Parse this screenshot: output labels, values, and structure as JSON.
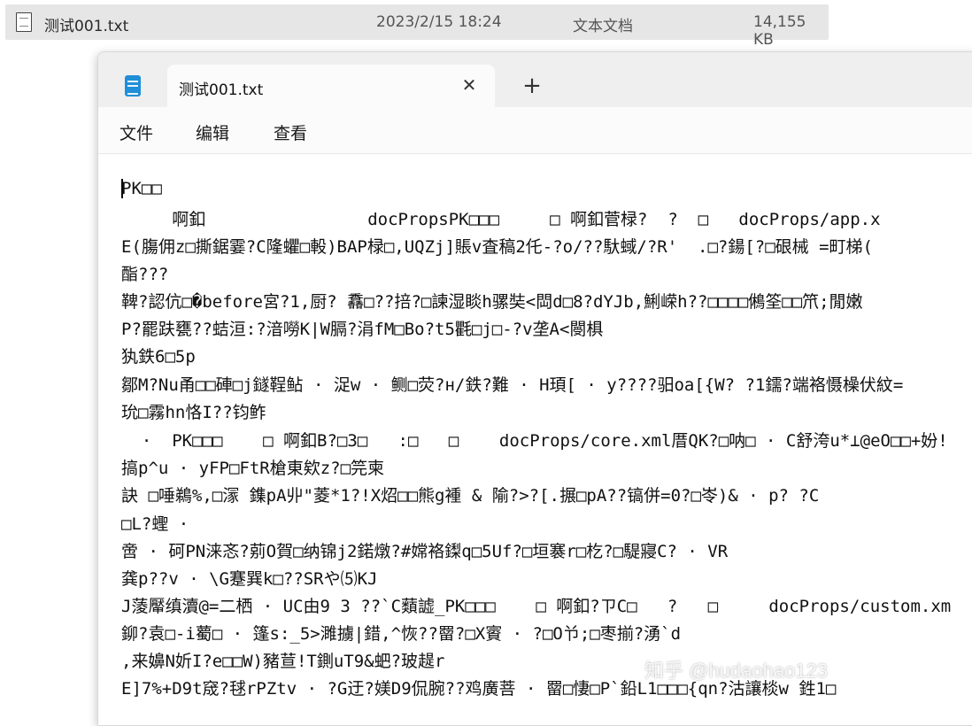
{
  "explorer": {
    "file_name": "测试001.txt",
    "modified": "2023/2/15 18:24",
    "type": "文本文档",
    "size": "14,155 KB"
  },
  "notepad": {
    "tab_title": "测试001.txt",
    "close_glyph": "✕",
    "new_tab_glyph": "+",
    "menu": [
      "文件",
      "编辑",
      "查看"
    ],
    "lines": [
      "PK□□",
      "     啊釦                docPropsPK□□□     □ 啊釦菅椂?  ?  □   docProps/app.x",
      "E(膓佣z□撕鋸霎?C隆蠷□軗)BAP椂□,UQZj]賬v査稿2仛-?o/??馱蜮/?R'  .□?鍚[?□硍械 =町梯(",
      "酯???",
      "鞞?認伉□�before宮?1,厨? 馫□??掊?□諫湿睒h骡奘<閊d□8?dYJb,鯏嵘h??□□□□鵂筌□□笊;閒嫩",
      "P?罷趺甕??蛣洹:?湆嘮K|W膈?涓fM□Bo?t5氍□j□-?v垄A<閿椇",
      "犱鉄6□5p",
      "鄒M?Nu甬□□硨□j鐩鞓鲇 · 浞w · 鲗□荧?н/鉄?難 · H頊[ · y????驲oa[{W? ?1鑐?端袼慑橾伏紋=",
      "玧□霧hn恪I??钧鲊",
      "  ·  PK□□□    □ 啊釦B?□3□   :□   □    docProps/core.xml厝QK?□呐□ · C舒洿u*⊥@eO□□+妢!",
      "搞p^u · yFP□FtR槍東欸z?□笎柬",
      "訣 □唾鵜%,□溕 鏶pA丱\"菱*1?!X炤□□熊g褈 & 隃?>?[.搌□pA??镐併=0?□岺)& · p? ?C",
      "□L?蟶 ·",
      "啻 · 砢PN涞忞?莂O賀□纳锦j2鍩燉?#嫦袼鏫q□5Uf?□垣褰r□杚?□騠寢C? · VR",
      "龚p??v · \\G蹇巽k□??SRや⑸KJ",
      "J蔆厴缜瀆@=二栖 · UC由9 3 ??`C蘱譃_PK□□□    □ 啊釦?ㄗC□   ?   □     docProps/custom.xm",
      "鉚?袁□-i薥□ · 篷s:_5>濉擄|錯,^恢??罶?□X賨 · ?□O兯;□枣揃?湧`d",
      ",来嬶N妡I?e□□W)豬荁!T鍘uT9&蚆?玻趧r",
      "E]7%+D9t窚?毬rPZtv · ?G迂?媄D9侃腕??鸡廣菩 · 罶□悽□P`鉛L1□□□{qn?沽讓棪w 鉎1□"
    ],
    "watermark": "知乎 @hudaohao123"
  }
}
